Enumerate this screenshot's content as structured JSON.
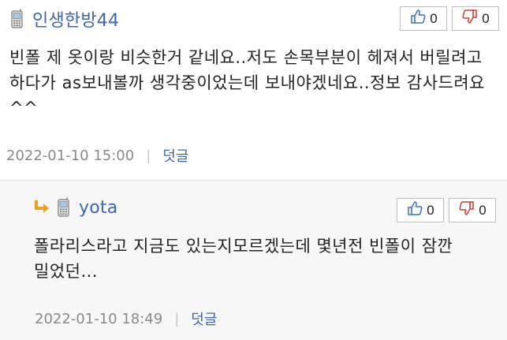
{
  "comments": [
    {
      "author": "인생한방44",
      "like_count": "0",
      "dislike_count": "0",
      "text": "빈폴 제 옷이랑 비슷한거 같네요..저도 손목부분이 헤져서 버릴려고 하다가 as보내볼까 생각중이었는데 보내야겠네요..정보 감사드려요^^",
      "datetime": "2022-01-10 15:00",
      "reply_label": "덧글"
    },
    {
      "author": "yota",
      "like_count": "0",
      "dislike_count": "0",
      "text": "폴라리스라고 지금도 있는지모르겠는데 몇년전 빈폴이 잠깐 밀었던...",
      "datetime": "2022-01-10 18:49",
      "reply_label": "덧글"
    }
  ],
  "colors": {
    "author": "#3f66b0",
    "meta": "#8a8a8a",
    "reply_bg": "#f7f7f7",
    "like": "#3b6fd1",
    "dislike": "#d23c2c",
    "reply_arrow": "#f0a020"
  },
  "icons": [
    "mobile-phone-icon",
    "thumbs-up-icon",
    "thumbs-down-icon",
    "reply-arrow-icon"
  ]
}
